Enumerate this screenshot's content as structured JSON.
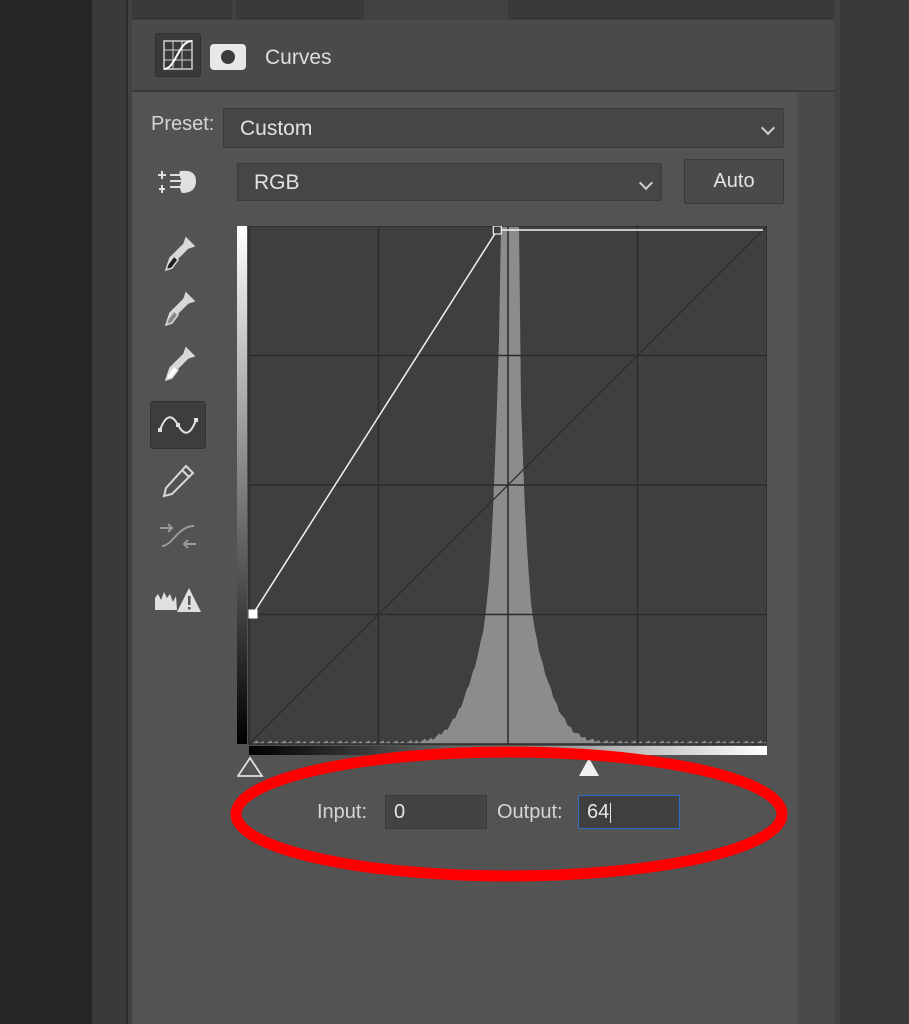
{
  "panel": {
    "title": "Curves"
  },
  "preset": {
    "label": "Preset:",
    "value": "Custom"
  },
  "channel": {
    "value": "RGB"
  },
  "auto_button": {
    "label": "Auto"
  },
  "tools": [
    {
      "name": "on-image-adjust-icon"
    },
    {
      "name": "black-point-eyedropper-icon"
    },
    {
      "name": "gray-point-eyedropper-icon"
    },
    {
      "name": "white-point-eyedropper-icon"
    },
    {
      "name": "curve-points-icon",
      "selected": true
    },
    {
      "name": "pencil-icon"
    },
    {
      "name": "smooth-curve-icon"
    },
    {
      "name": "clipping-warning-icon"
    }
  ],
  "curve": {
    "points": [
      [
        0,
        64
      ],
      [
        255,
        255
      ]
    ],
    "histogram_peak_input": 128
  },
  "io": {
    "input_label": "Input:",
    "input_value": "0",
    "output_label": "Output:",
    "output_value": "64"
  },
  "colors": {
    "highlight": "#ff0000",
    "focus_border": "#2f6dc7"
  }
}
